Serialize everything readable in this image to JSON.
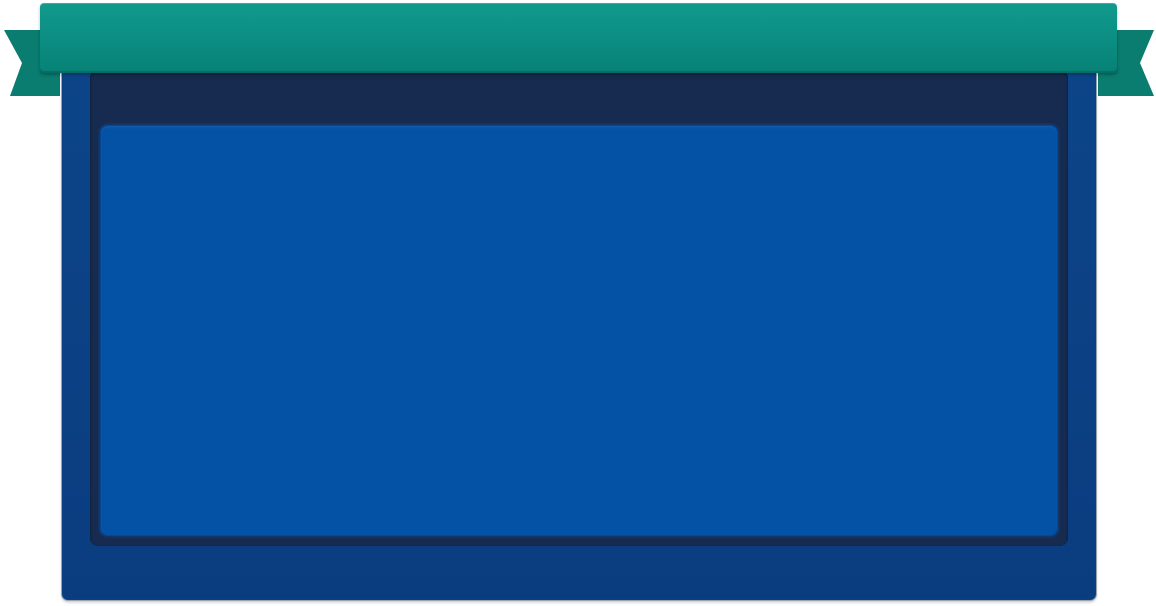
{
  "banner": {
    "title": ""
  },
  "colors": {
    "banner": "#0b8d82",
    "ribbon_tail": "#0a7d70",
    "panel_frame": "#0b3f83",
    "header_band": "#162b4f",
    "content_area": "#0452a5"
  },
  "content": {
    "text": ""
  }
}
